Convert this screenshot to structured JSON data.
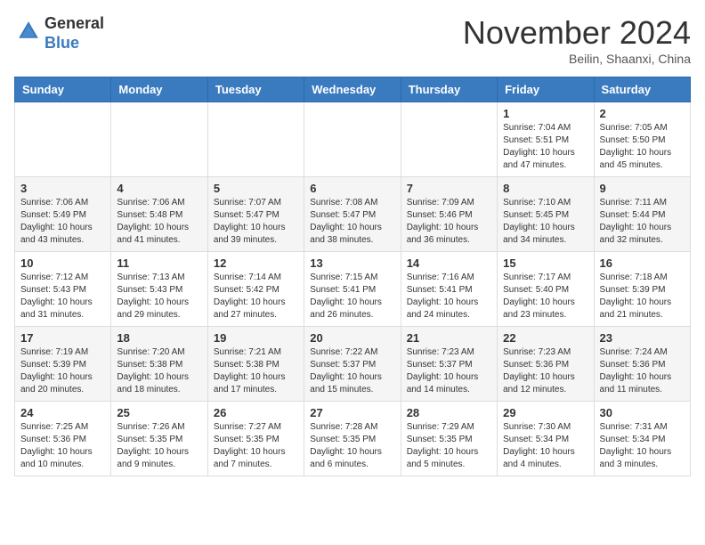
{
  "header": {
    "logo_line1": "General",
    "logo_line2": "Blue",
    "month_title": "November 2024",
    "location": "Beilin, Shaanxi, China"
  },
  "weekdays": [
    "Sunday",
    "Monday",
    "Tuesday",
    "Wednesday",
    "Thursday",
    "Friday",
    "Saturday"
  ],
  "weeks": [
    [
      {
        "day": "",
        "info": ""
      },
      {
        "day": "",
        "info": ""
      },
      {
        "day": "",
        "info": ""
      },
      {
        "day": "",
        "info": ""
      },
      {
        "day": "",
        "info": ""
      },
      {
        "day": "1",
        "info": "Sunrise: 7:04 AM\nSunset: 5:51 PM\nDaylight: 10 hours\nand 47 minutes."
      },
      {
        "day": "2",
        "info": "Sunrise: 7:05 AM\nSunset: 5:50 PM\nDaylight: 10 hours\nand 45 minutes."
      }
    ],
    [
      {
        "day": "3",
        "info": "Sunrise: 7:06 AM\nSunset: 5:49 PM\nDaylight: 10 hours\nand 43 minutes."
      },
      {
        "day": "4",
        "info": "Sunrise: 7:06 AM\nSunset: 5:48 PM\nDaylight: 10 hours\nand 41 minutes."
      },
      {
        "day": "5",
        "info": "Sunrise: 7:07 AM\nSunset: 5:47 PM\nDaylight: 10 hours\nand 39 minutes."
      },
      {
        "day": "6",
        "info": "Sunrise: 7:08 AM\nSunset: 5:47 PM\nDaylight: 10 hours\nand 38 minutes."
      },
      {
        "day": "7",
        "info": "Sunrise: 7:09 AM\nSunset: 5:46 PM\nDaylight: 10 hours\nand 36 minutes."
      },
      {
        "day": "8",
        "info": "Sunrise: 7:10 AM\nSunset: 5:45 PM\nDaylight: 10 hours\nand 34 minutes."
      },
      {
        "day": "9",
        "info": "Sunrise: 7:11 AM\nSunset: 5:44 PM\nDaylight: 10 hours\nand 32 minutes."
      }
    ],
    [
      {
        "day": "10",
        "info": "Sunrise: 7:12 AM\nSunset: 5:43 PM\nDaylight: 10 hours\nand 31 minutes."
      },
      {
        "day": "11",
        "info": "Sunrise: 7:13 AM\nSunset: 5:43 PM\nDaylight: 10 hours\nand 29 minutes."
      },
      {
        "day": "12",
        "info": "Sunrise: 7:14 AM\nSunset: 5:42 PM\nDaylight: 10 hours\nand 27 minutes."
      },
      {
        "day": "13",
        "info": "Sunrise: 7:15 AM\nSunset: 5:41 PM\nDaylight: 10 hours\nand 26 minutes."
      },
      {
        "day": "14",
        "info": "Sunrise: 7:16 AM\nSunset: 5:41 PM\nDaylight: 10 hours\nand 24 minutes."
      },
      {
        "day": "15",
        "info": "Sunrise: 7:17 AM\nSunset: 5:40 PM\nDaylight: 10 hours\nand 23 minutes."
      },
      {
        "day": "16",
        "info": "Sunrise: 7:18 AM\nSunset: 5:39 PM\nDaylight: 10 hours\nand 21 minutes."
      }
    ],
    [
      {
        "day": "17",
        "info": "Sunrise: 7:19 AM\nSunset: 5:39 PM\nDaylight: 10 hours\nand 20 minutes."
      },
      {
        "day": "18",
        "info": "Sunrise: 7:20 AM\nSunset: 5:38 PM\nDaylight: 10 hours\nand 18 minutes."
      },
      {
        "day": "19",
        "info": "Sunrise: 7:21 AM\nSunset: 5:38 PM\nDaylight: 10 hours\nand 17 minutes."
      },
      {
        "day": "20",
        "info": "Sunrise: 7:22 AM\nSunset: 5:37 PM\nDaylight: 10 hours\nand 15 minutes."
      },
      {
        "day": "21",
        "info": "Sunrise: 7:23 AM\nSunset: 5:37 PM\nDaylight: 10 hours\nand 14 minutes."
      },
      {
        "day": "22",
        "info": "Sunrise: 7:23 AM\nSunset: 5:36 PM\nDaylight: 10 hours\nand 12 minutes."
      },
      {
        "day": "23",
        "info": "Sunrise: 7:24 AM\nSunset: 5:36 PM\nDaylight: 10 hours\nand 11 minutes."
      }
    ],
    [
      {
        "day": "24",
        "info": "Sunrise: 7:25 AM\nSunset: 5:36 PM\nDaylight: 10 hours\nand 10 minutes."
      },
      {
        "day": "25",
        "info": "Sunrise: 7:26 AM\nSunset: 5:35 PM\nDaylight: 10 hours\nand 9 minutes."
      },
      {
        "day": "26",
        "info": "Sunrise: 7:27 AM\nSunset: 5:35 PM\nDaylight: 10 hours\nand 7 minutes."
      },
      {
        "day": "27",
        "info": "Sunrise: 7:28 AM\nSunset: 5:35 PM\nDaylight: 10 hours\nand 6 minutes."
      },
      {
        "day": "28",
        "info": "Sunrise: 7:29 AM\nSunset: 5:35 PM\nDaylight: 10 hours\nand 5 minutes."
      },
      {
        "day": "29",
        "info": "Sunrise: 7:30 AM\nSunset: 5:34 PM\nDaylight: 10 hours\nand 4 minutes."
      },
      {
        "day": "30",
        "info": "Sunrise: 7:31 AM\nSunset: 5:34 PM\nDaylight: 10 hours\nand 3 minutes."
      }
    ]
  ]
}
